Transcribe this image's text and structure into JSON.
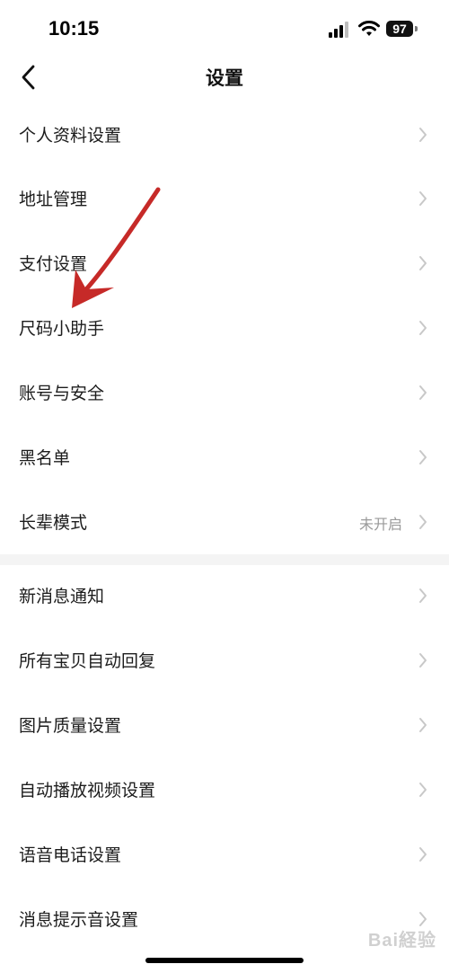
{
  "status_bar": {
    "time": "10:15",
    "battery_level": "97",
    "icons": [
      "signal-icon",
      "wifi-icon",
      "battery-icon"
    ]
  },
  "nav": {
    "title": "设置",
    "back_icon": "chevron-left-icon"
  },
  "section1": [
    {
      "label": "个人资料设置"
    },
    {
      "label": "地址管理"
    },
    {
      "label": "支付设置"
    },
    {
      "label": "尺码小助手"
    },
    {
      "label": "账号与安全"
    },
    {
      "label": "黑名单"
    },
    {
      "label": "长辈模式",
      "value": "未开启"
    }
  ],
  "section2": [
    {
      "label": "新消息通知"
    },
    {
      "label": "所有宝贝自动回复"
    },
    {
      "label": "图片质量设置"
    },
    {
      "label": "自动播放视频设置"
    },
    {
      "label": "语音电话设置"
    },
    {
      "label": "消息提示音设置"
    }
  ],
  "watermark": "Bai経验",
  "colors": {
    "chevron": "#c8c8c8",
    "annotation_arrow": "#c62a28",
    "divider": "#f4f4f4"
  }
}
